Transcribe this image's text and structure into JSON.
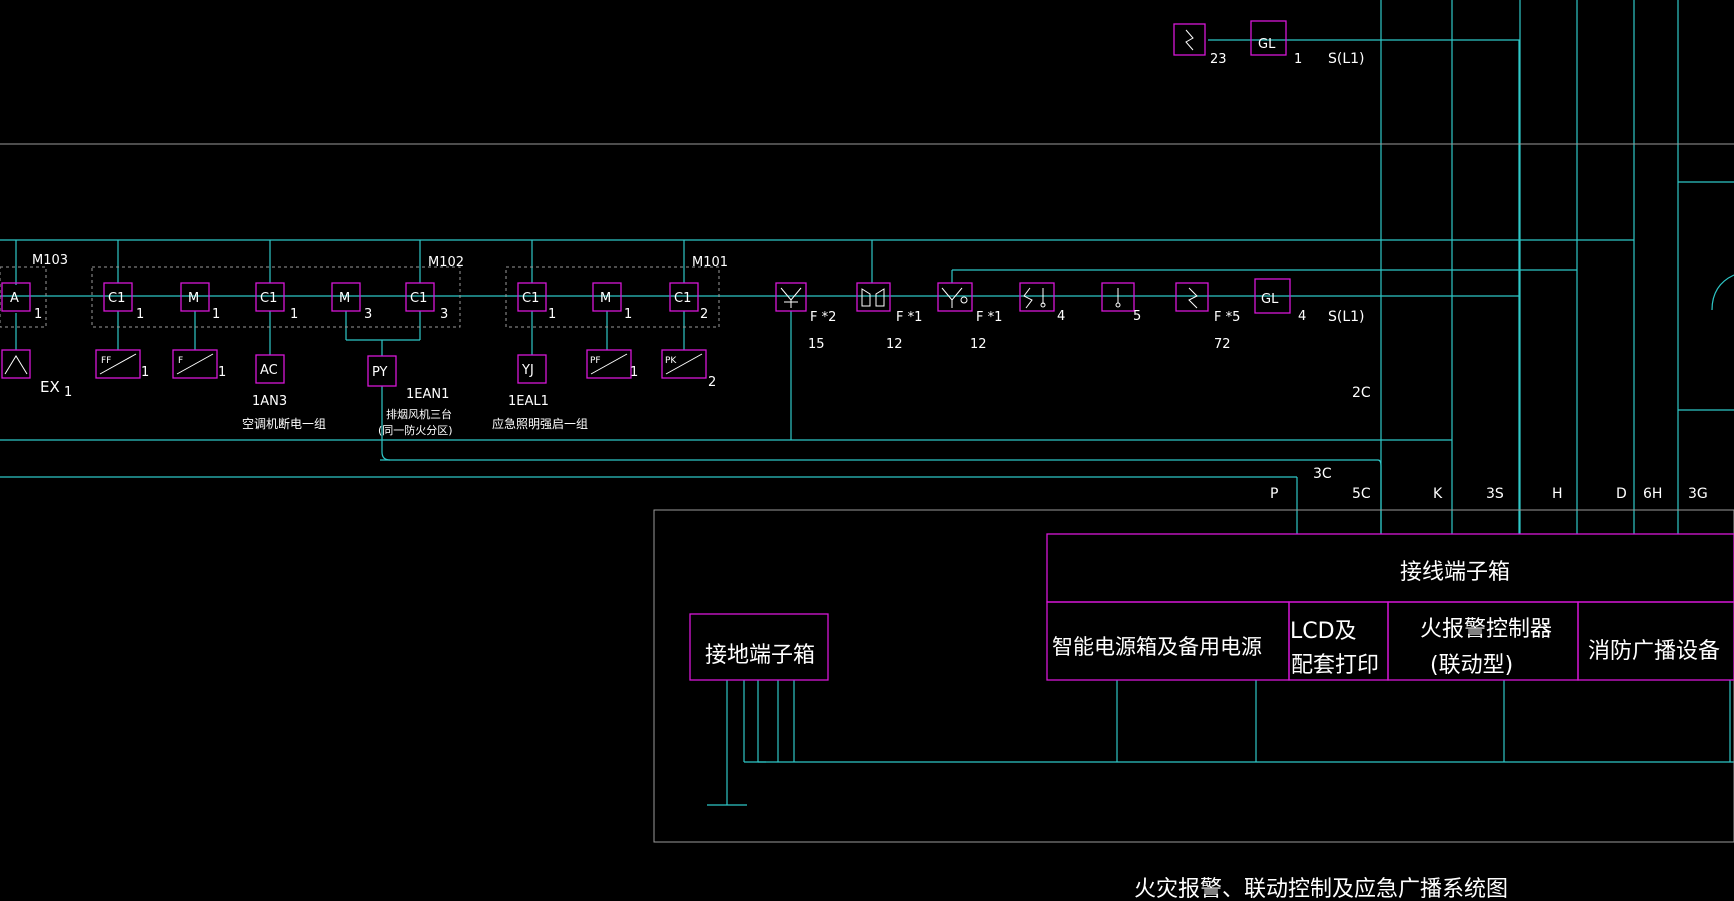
{
  "colors": {
    "wire": "#2ec7c7",
    "device": "#d617d6",
    "text": "#ffffff",
    "frame": "#9a9a9a",
    "background": "#000000"
  },
  "header_row": {
    "num_left": "23",
    "gl": "GL",
    "num_right": "1",
    "sline": "S(L1)"
  },
  "modules": {
    "m103": "M103",
    "m102": "M102",
    "m101": "M101"
  },
  "devices": {
    "a": "A",
    "c1": "C1",
    "m": "M",
    "ac": "AC",
    "py": "PY",
    "yj": "YJ",
    "gl": "GL",
    "ff": "FF",
    "f": "F",
    "pf": "PF",
    "pk": "PK"
  },
  "counts": {
    "a": "1",
    "c1_a": "1",
    "m_a": "1",
    "c1_b": "1",
    "m_b": "3",
    "c1_c": "3",
    "c1_d": "1",
    "m_c": "1",
    "c1_e": "2",
    "ff": "1",
    "f": "1",
    "pf": "1",
    "pk": "2",
    "ex": "1",
    "bell": "4",
    "therm": "5",
    "gl": "4"
  },
  "labels": {
    "ex": "EX",
    "an3": "1AN3",
    "an3_desc": "空调机断电一组",
    "ean1": "1EAN1",
    "ean1_desc1": "排烟风机三台",
    "ean1_desc2": "(同一防火分区)",
    "eal1": "1EAL1",
    "eal1_desc": "应急照明强启一组",
    "s2": "S(L1)",
    "fmark_1": "F *2",
    "fmark_2": "F *1",
    "fmark_3": "F *1",
    "fmark_4": "F *5",
    "fnum_1": "15",
    "fnum_2": "12",
    "fnum_3": "12",
    "fnum_4": "72"
  },
  "buses": {
    "b2c": "2C",
    "b3c": "3C",
    "p": "P",
    "b5c": "5C",
    "k": "K",
    "b3s": "3S",
    "h": "H",
    "d": "D",
    "b6h": "6H",
    "b3g": "3G"
  },
  "boxes": {
    "terminal": "接线端子箱",
    "power": "智能电源箱及备用电源",
    "lcd1": "LCD及",
    "lcd2": "配套打印",
    "fire1": "火报警控制器",
    "fire2": "(联动型)",
    "broadcast": "消防广播设备",
    "ground": "接地端子箱"
  },
  "title": "火灾报警、联动控制及应急广播系统图"
}
